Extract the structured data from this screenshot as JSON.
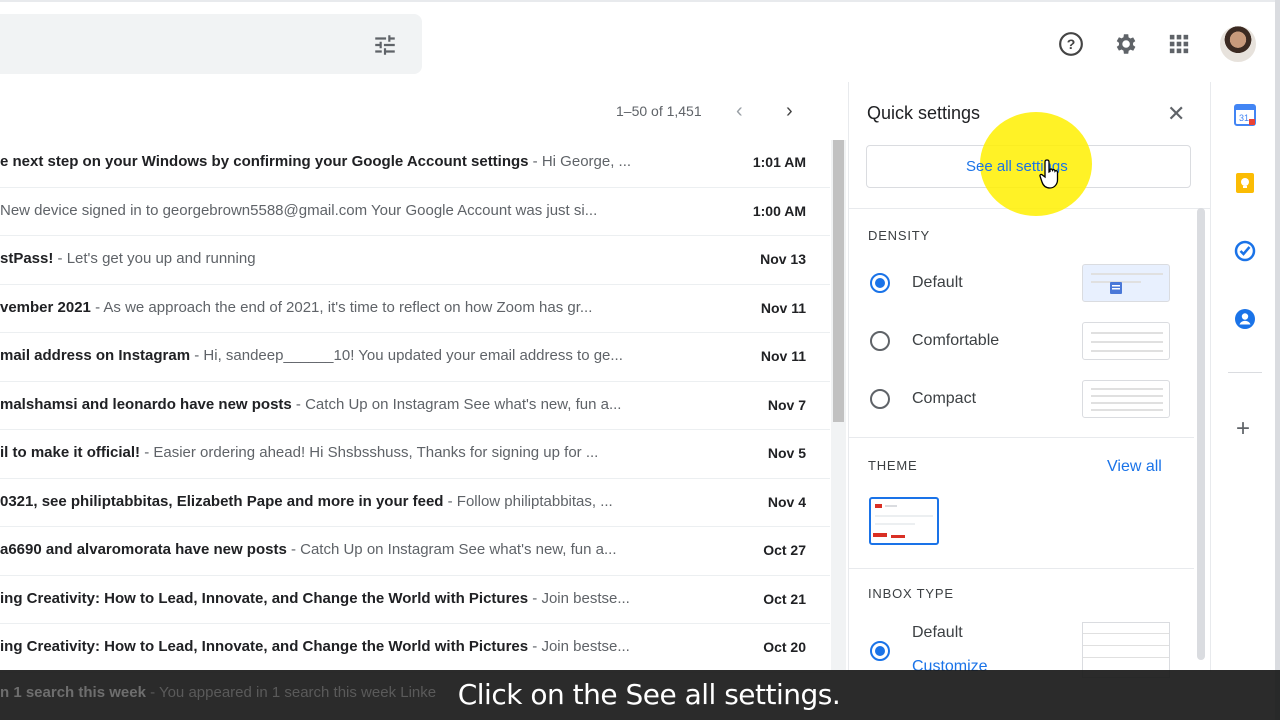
{
  "colors": {
    "accent": "#1a73e8",
    "highlight": "#fff000",
    "caption_bg": "#191919"
  },
  "header": {
    "search_tune_icon": "tune-icon",
    "help_icon": "help-icon",
    "settings_icon": "gear-icon",
    "apps_icon": "apps-grid-icon",
    "account_icon": "avatar"
  },
  "pagination": {
    "count": "1–50 of 1,451",
    "prev": "‹",
    "next": "›"
  },
  "emails": [
    {
      "subject": "e next step on your Windows by confirming your Google Account settings",
      "snippet": " - Hi George, ...",
      "date": "1:01 AM",
      "unread": true
    },
    {
      "subject": "",
      "snippet": "New device signed in to georgebrown5588@gmail.com Your Google Account was just si...",
      "date": "1:00 AM",
      "unread": true
    },
    {
      "subject": "stPass!",
      "snippet": " - Let's get you up and running",
      "date": "Nov 13",
      "unread": true
    },
    {
      "subject": "vember 2021",
      "snippet": " - As we approach the end of 2021, it's time to reflect on how Zoom has gr...",
      "date": "Nov 11",
      "unread": true
    },
    {
      "subject": "mail address on Instagram",
      "snippet": " - Hi, sandeep______10! You updated your email address to ge...",
      "date": "Nov 11",
      "unread": true
    },
    {
      "subject": "malshamsi and leonardo have new posts",
      "snippet": " - Catch Up on Instagram See what's new, fun a...",
      "date": "Nov 7",
      "unread": true
    },
    {
      "subject": "il to make it official!",
      "snippet": " - Easier ordering ahead! Hi Shsbsshuss, Thanks for signing up for ...",
      "date": "Nov 5",
      "unread": true
    },
    {
      "subject": "0321, see philiptabbitas, Elizabeth Pape and more in your feed",
      "snippet": " - Follow philiptabbitas, ...",
      "date": "Nov 4",
      "unread": true
    },
    {
      "subject": "a6690 and alvaromorata have new posts",
      "snippet": " - Catch Up on Instagram See what's new, fun a...",
      "date": "Oct 27",
      "unread": true
    },
    {
      "subject": "ing Creativity: How to Lead, Innovate, and Change the World with Pictures",
      "snippet": " - Join bestse...",
      "date": "Oct 21",
      "unread": true
    },
    {
      "subject": "ing Creativity: How to Lead, Innovate, and Change the World with Pictures",
      "snippet": " - Join bestse...",
      "date": "Oct 20",
      "unread": true
    }
  ],
  "quick_settings": {
    "title": "Quick settings",
    "close_icon": "close-icon",
    "see_all_label": "See all settings",
    "density": {
      "heading": "DENSITY",
      "options": [
        {
          "label": "Default",
          "selected": true
        },
        {
          "label": "Comfortable",
          "selected": false
        },
        {
          "label": "Compact",
          "selected": false
        }
      ]
    },
    "theme": {
      "heading": "THEME",
      "view_all": "View all"
    },
    "inbox_type": {
      "heading": "INBOX TYPE",
      "option": "Default",
      "customize": "Customize"
    }
  },
  "side_panel": {
    "icons": [
      "calendar-icon",
      "keep-icon",
      "tasks-icon",
      "contacts-icon"
    ],
    "calendar_day": "31",
    "add_label": "+"
  },
  "caption": {
    "partial_row": "n 1 search this week",
    "partial_snippet": " - You appeared in 1 search this week Linke",
    "text": "Click on the See all settings."
  }
}
